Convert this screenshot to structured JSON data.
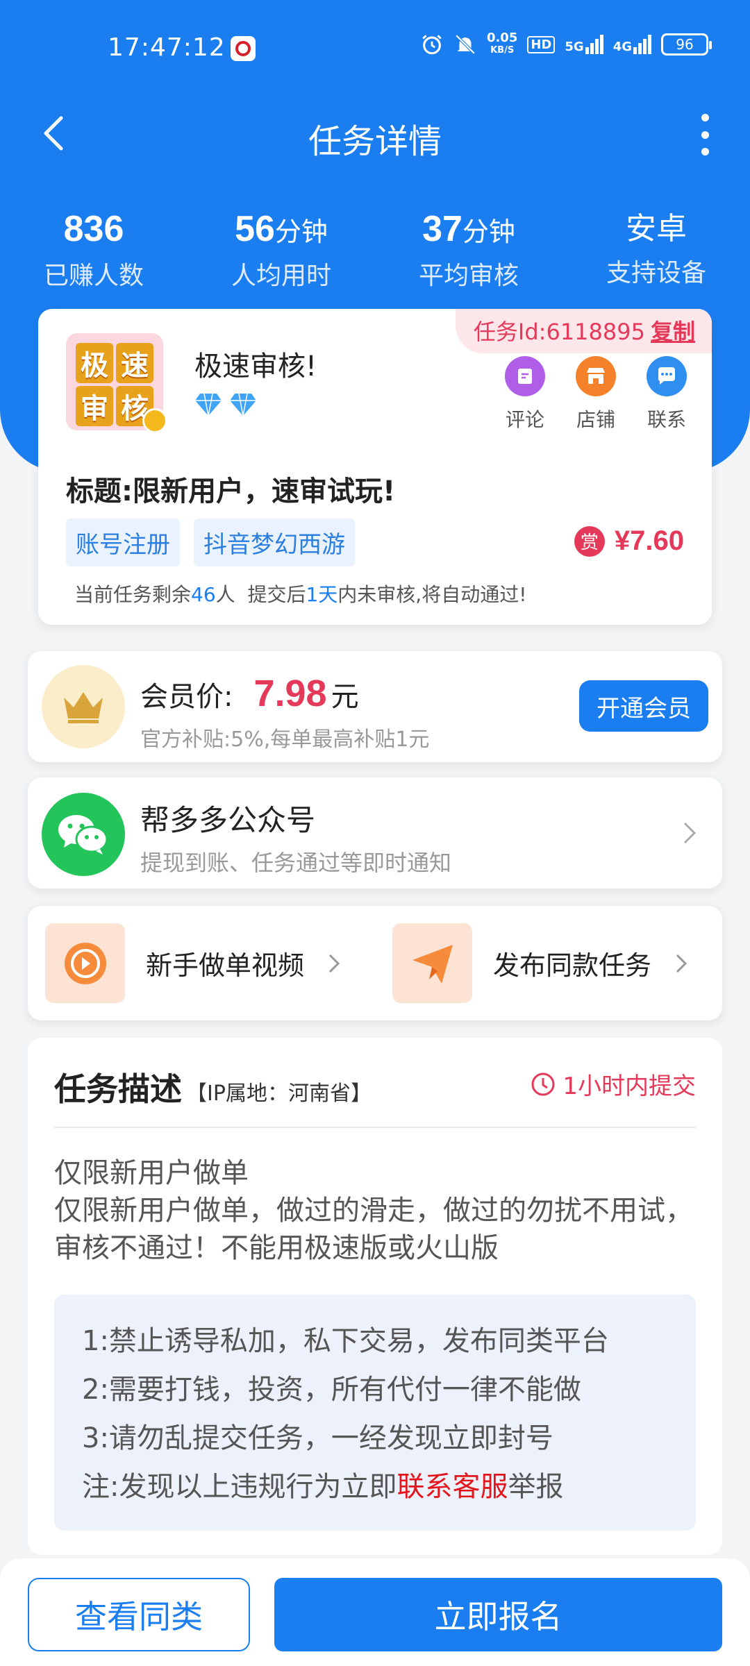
{
  "status_bar": {
    "time": "17:47:12",
    "net_speed_value": "0.05",
    "net_speed_unit": "KB/S",
    "hd": "HD",
    "signal1": "5G",
    "signal2": "4G",
    "battery": "96"
  },
  "nav": {
    "title": "任务详情"
  },
  "stats": [
    {
      "value": "836",
      "unit": "",
      "label": "已赚人数"
    },
    {
      "value": "56",
      "unit": "分钟",
      "label": "人均用时"
    },
    {
      "value": "37",
      "unit": "分钟",
      "label": "平均审核"
    },
    {
      "value": "安卓",
      "unit": "",
      "label": "支持设备"
    }
  ],
  "task": {
    "id_label": "任务Id:6118895",
    "copy_label": "复制",
    "logo_chars": [
      "极",
      "速",
      "审",
      "核"
    ],
    "app_name": "极速审核!",
    "actions": [
      {
        "label": "评论",
        "color": "#b05ee8"
      },
      {
        "label": "店铺",
        "color": "#f5822a"
      },
      {
        "label": "联系",
        "color": "#2f8ff0"
      }
    ],
    "title": "标题:限新用户，速审试玩!",
    "tags": [
      "账号注册",
      "抖音梦幻西游"
    ],
    "reward_badge": "赏",
    "reward": "¥7.60",
    "remain_pre": "当前任务剩余",
    "remain_count": "46",
    "remain_mid": "人  提交后",
    "remain_days": "1天",
    "remain_post": "内未审核,将自动通过!"
  },
  "member": {
    "label": "会员价:",
    "price": "7.98",
    "unit": "元",
    "sub": "官方补贴:5%,每单最高补贴1元",
    "button": "开通会员"
  },
  "wechat": {
    "title": "帮多多公众号",
    "sub": "提现到账、任务通过等即时通知"
  },
  "shortcuts": [
    {
      "label": "新手做单视频"
    },
    {
      "label": "发布同款任务"
    }
  ],
  "description": {
    "heading": "任务描述",
    "ip": "【IP属地：河南省】",
    "deadline": "1小时内提交",
    "line1": "仅限新用户做单",
    "line2": "仅限新用户做单，做过的滑走，做过的勿扰不用试，审核不通过！不能用极速版或火山版",
    "rules": [
      "1:禁止诱导私加，私下交易，发布同类平台",
      "2:需要打钱，投资，所有代付一律不能做",
      "3:请勿乱提交任务，一经发现立即封号"
    ],
    "note_pre": "注:发现以上违规行为立即",
    "note_link": "联系客服",
    "note_post": "举报"
  },
  "bottom": {
    "secondary": "查看同类",
    "primary": "立即报名"
  }
}
